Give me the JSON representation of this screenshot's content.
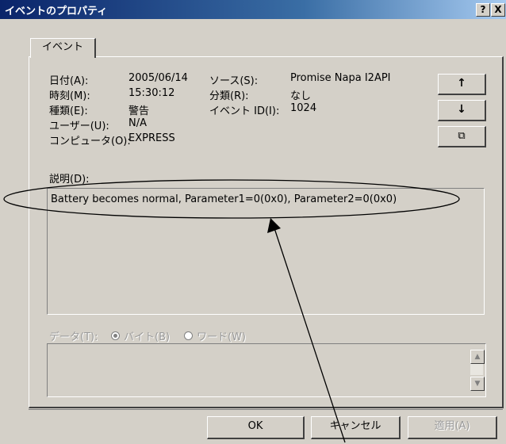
{
  "window": {
    "title": "イベントのプロパティ"
  },
  "titlebar_buttons": {
    "help": "?",
    "close": "X"
  },
  "tab": {
    "label": "イベント"
  },
  "fields_left": [
    {
      "label": "日付(A):",
      "value": "2005/06/14"
    },
    {
      "label": "時刻(M):",
      "value": "15:30:12"
    },
    {
      "label": "種類(E):",
      "value": "警告"
    },
    {
      "label": "ユーザー(U):",
      "value": "N/A"
    },
    {
      "label": "コンピュータ(O):",
      "value": "EXPRESS"
    }
  ],
  "fields_right": [
    {
      "label": "ソース(S):",
      "value": "Promise Napa I2API"
    },
    {
      "label": "分類(R):",
      "value": "なし"
    },
    {
      "label": "イベント ID(I):",
      "value": "1024"
    }
  ],
  "description": {
    "label": "説明(D):",
    "text": "Battery becomes normal, Parameter1=0(0x0), Parameter2=0(0x0)"
  },
  "data_section": {
    "label": "データ(T):",
    "options": [
      "バイト(B)",
      "ワード(W)"
    ],
    "selected": "バイト(B)"
  },
  "side_buttons": [
    {
      "name": "up-arrow-icon",
      "glyph": "↑"
    },
    {
      "name": "down-arrow-icon",
      "glyph": "↓"
    },
    {
      "name": "copy-icon",
      "glyph": "⧉"
    }
  ],
  "footer": {
    "ok": "OK",
    "cancel": "キャンセル",
    "apply": "適用(A)"
  },
  "colors": {
    "titlebar_start": "#0a246a",
    "titlebar_end": "#a6caf0",
    "face": "#d4d0c8",
    "annotation": "#000000"
  }
}
